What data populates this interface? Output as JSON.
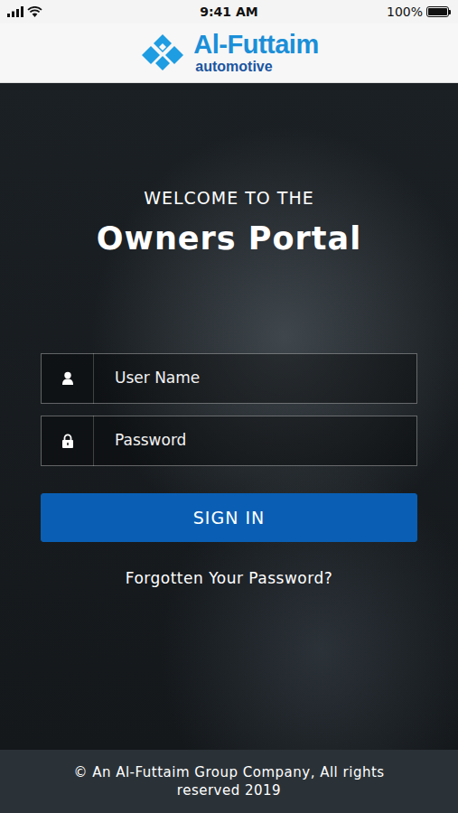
{
  "status_bar": {
    "time": "9:41 AM",
    "battery": "100%",
    "battery_level": 1.0
  },
  "header": {
    "brand": "Al-Futtaim",
    "subbrand": "automotive"
  },
  "welcome": {
    "kicker": "WELCOME TO THE",
    "title": "Owners Portal"
  },
  "fields": [
    {
      "placeholder": "User Name",
      "kind": "text"
    },
    {
      "placeholder": "Password",
      "kind": "password"
    }
  ],
  "sign_in": "SIGN IN",
  "forgot": "Forgotten Your Password?",
  "footer": "© An Al-Futtaim Group Company, All rights reserved 2019"
}
